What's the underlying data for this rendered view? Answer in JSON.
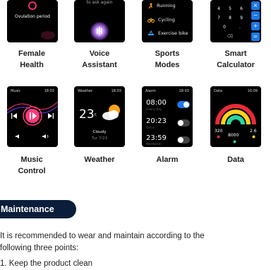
{
  "features_row1": [
    {
      "caption": "Female\nHealth",
      "screen_text": "Ovulation period"
    },
    {
      "caption": "Voice\nAssistant",
      "screen_text": "to ask again"
    },
    {
      "caption": "Sports\nModes",
      "items": [
        "Running",
        "Cycling",
        "Exercise bike"
      ]
    },
    {
      "caption": "Smart\nCalculator",
      "keys": [
        "4",
        "5",
        "6",
        "7",
        "8",
        "9",
        "0",
        "."
      ],
      "ops": [
        "×",
        "−",
        "+",
        "="
      ]
    }
  ],
  "features_row2": [
    {
      "caption": "Music\nControl",
      "title": "Music",
      "time": "18:03"
    },
    {
      "caption": "Weather",
      "title": "Weather",
      "time": "18:03",
      "temp": "23",
      "unit": "c",
      "condition": "Cloudy",
      "date": "Tur 7/23"
    },
    {
      "caption": "Alarm",
      "title": "Alarm",
      "time": "18:03",
      "alarms": [
        {
          "time": "08:00",
          "sub": "Every day",
          "on": true
        },
        {
          "time": "20:23",
          "sub": "Once",
          "on": false
        },
        {
          "time": "23:59",
          "sub": "Weekend",
          "on": false
        }
      ]
    },
    {
      "caption": "Data",
      "title": "Data",
      "time": "10:09",
      "values": [
        "320",
        "8000",
        "2.6"
      ]
    }
  ],
  "maintenance": {
    "heading": "Maintenance",
    "intro_line1": "It is recommended to wear and maintain according to the",
    "intro_line2": "following three points:",
    "point1": "1. Keep the product clean"
  },
  "colors": {
    "accent_blue": "#1a78e8",
    "badge_navy": "#0a1d3a",
    "pink": "#e8336a"
  }
}
